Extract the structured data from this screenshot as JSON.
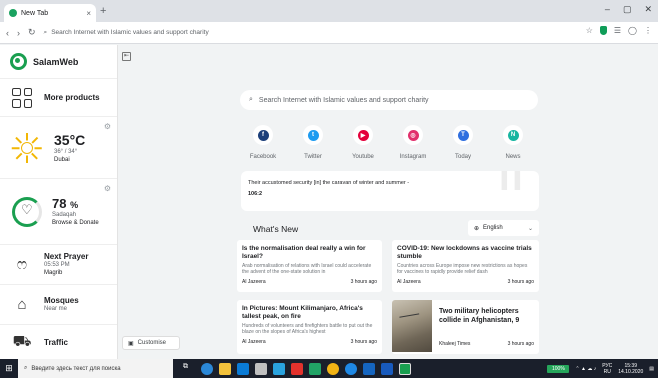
{
  "browser": {
    "tab_title": "New Tab",
    "address_placeholder": "Search Internet with Islamic values and support charity"
  },
  "sidebar": {
    "brand": "SalamWeb",
    "more_products": "More products",
    "weather": {
      "temp": "35°C",
      "range": "36° / 34°",
      "city": "Dubai"
    },
    "sadaqah": {
      "percent": "78",
      "percent_unit": "%",
      "title": "Sadaqah",
      "subtitle": "Browse & Donate"
    },
    "prayer": {
      "title": "Next Prayer",
      "time": "05:53 PM",
      "name": "Magrib"
    },
    "mosques": {
      "title": "Mosques",
      "subtitle": "Near me"
    },
    "traffic": {
      "title": "Traffic"
    }
  },
  "main": {
    "search_placeholder": "Search Internet with Islamic values and support charity",
    "shortcuts": [
      {
        "label": "Facebook",
        "color": "#1c3f7a",
        "glyph": "f"
      },
      {
        "label": "Twitter",
        "color": "#1d9bf0",
        "glyph": "t"
      },
      {
        "label": "Youtube",
        "color": "#e4003b",
        "glyph": "▶"
      },
      {
        "label": "Instagram",
        "color": "#e1306c",
        "glyph": "◎"
      },
      {
        "label": "Today",
        "color": "#2f6fdf",
        "glyph": "T"
      },
      {
        "label": "News",
        "color": "#17b5a0",
        "glyph": "N"
      }
    ],
    "quote": {
      "text": "Their accustomed security [in] the caravan of winter and summer -",
      "ref": "106:2"
    },
    "news_heading": "What's New",
    "language": "English",
    "customise": "Customise",
    "news": [
      {
        "title": "Is the normalisation deal really a win for Israel?",
        "desc": "Arab normalisation of relations with Israel could accelerate the advent of the one-state solution in",
        "source": "Al Jazeera",
        "time": "3 hours ago"
      },
      {
        "title": "COVID-19: New lockdowns as vaccine trials stumble",
        "desc": "Countries across Europe impose new restrictions as hopes for vaccines to rapidly provide relief dash",
        "source": "Al Jazeera",
        "time": "3 hours ago"
      },
      {
        "title": "In Pictures: Mount Kilimanjaro, Africa's tallest peak, on fire",
        "desc": "Hundreds of volunteers and firefighters battle to put out the blaze on the slopes of Africa's highest",
        "source": "Al Jazeera",
        "time": "3 hours ago"
      },
      {
        "title": "Two military helicopters collide in Afghanistan, 9",
        "desc": "",
        "source": "Khaleej Times",
        "time": "3 hours ago"
      }
    ]
  },
  "taskbar": {
    "search_placeholder": "Введите здесь текст для поиска",
    "battery": "100%",
    "lang": "РУС",
    "lang2": "RU",
    "time": "15:39",
    "date": "14.10.2020"
  }
}
